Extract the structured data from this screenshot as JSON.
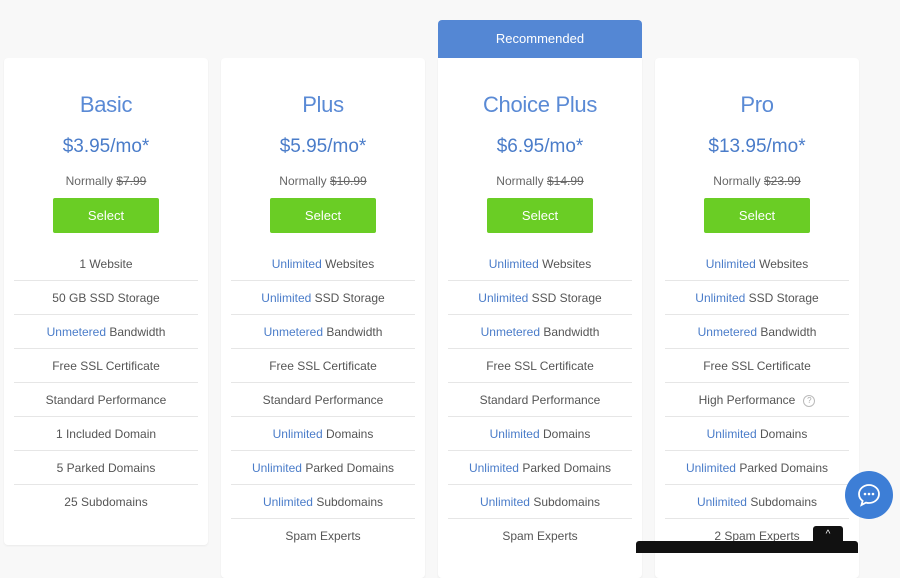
{
  "recommended_label": "Recommended",
  "plans": [
    {
      "name": "Basic",
      "price": "$3.95/mo*",
      "normally_label": "Normally",
      "normal_price": "$7.99",
      "select_label": "Select",
      "features": [
        {
          "highlight": "",
          "text": "1 Website"
        },
        {
          "highlight": "",
          "text": "50 GB SSD Storage"
        },
        {
          "highlight": "Unmetered",
          "text": " Bandwidth"
        },
        {
          "highlight": "",
          "text": "Free SSL Certificate"
        },
        {
          "highlight": "",
          "text": "Standard Performance"
        },
        {
          "highlight": "",
          "text": "1 Included Domain"
        },
        {
          "highlight": "",
          "text": "5 Parked Domains"
        },
        {
          "highlight": "",
          "text": "25 Subdomains"
        }
      ]
    },
    {
      "name": "Plus",
      "price": "$5.95/mo*",
      "normally_label": "Normally",
      "normal_price": "$10.99",
      "select_label": "Select",
      "features": [
        {
          "highlight": "Unlimited",
          "text": " Websites"
        },
        {
          "highlight": "Unlimited",
          "text": " SSD Storage"
        },
        {
          "highlight": "Unmetered",
          "text": " Bandwidth"
        },
        {
          "highlight": "",
          "text": "Free SSL Certificate"
        },
        {
          "highlight": "",
          "text": "Standard Performance"
        },
        {
          "highlight": "Unlimited",
          "text": " Domains"
        },
        {
          "highlight": "Unlimited",
          "text": " Parked Domains"
        },
        {
          "highlight": "Unlimited",
          "text": " Subdomains"
        },
        {
          "highlight": "",
          "text": "Spam Experts"
        }
      ]
    },
    {
      "name": "Choice Plus",
      "price": "$6.95/mo*",
      "normally_label": "Normally",
      "normal_price": "$14.99",
      "select_label": "Select",
      "features": [
        {
          "highlight": "Unlimited",
          "text": " Websites"
        },
        {
          "highlight": "Unlimited",
          "text": " SSD Storage"
        },
        {
          "highlight": "Unmetered",
          "text": " Bandwidth"
        },
        {
          "highlight": "",
          "text": "Free SSL Certificate"
        },
        {
          "highlight": "",
          "text": "Standard Performance"
        },
        {
          "highlight": "Unlimited",
          "text": " Domains"
        },
        {
          "highlight": "Unlimited",
          "text": " Parked Domains"
        },
        {
          "highlight": "Unlimited",
          "text": " Subdomains"
        },
        {
          "highlight": "",
          "text": "Spam Experts"
        }
      ]
    },
    {
      "name": "Pro",
      "price": "$13.95/mo*",
      "normally_label": "Normally",
      "normal_price": "$23.99",
      "select_label": "Select",
      "features": [
        {
          "highlight": "Unlimited",
          "text": " Websites"
        },
        {
          "highlight": "Unlimited",
          "text": " SSD Storage"
        },
        {
          "highlight": "Unmetered",
          "text": " Bandwidth"
        },
        {
          "highlight": "",
          "text": "Free SSL Certificate"
        },
        {
          "highlight": "",
          "text": "High Performance",
          "help": "?"
        },
        {
          "highlight": "Unlimited",
          "text": " Domains"
        },
        {
          "highlight": "Unlimited",
          "text": " Parked Domains"
        },
        {
          "highlight": "Unlimited",
          "text": " Subdomains"
        },
        {
          "highlight": "",
          "text": "2 Spam Experts"
        }
      ]
    }
  ],
  "chat": {
    "icon": "chat-bubble-icon"
  },
  "scroll_top": {
    "glyph": "^"
  },
  "colors": {
    "accent_blue": "#5487d4",
    "select_green": "#6acd25",
    "text_highlight": "#4a7cc9"
  }
}
